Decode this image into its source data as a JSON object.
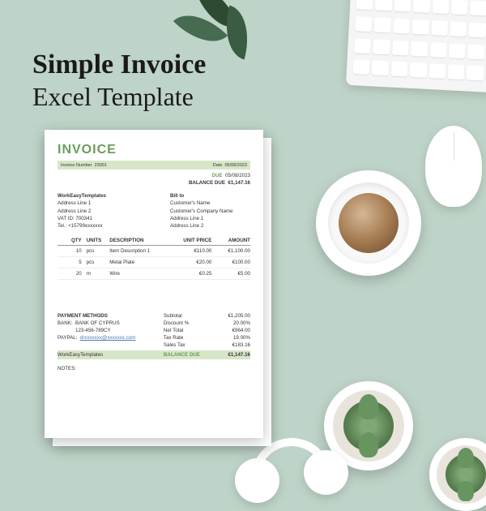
{
  "headline": {
    "line1": "Simple Invoice",
    "line2": "Excel Template"
  },
  "invoice": {
    "title": "INVOICE",
    "number_label": "Invoice Number",
    "number": "23001",
    "date_label": "Date",
    "date": "05/08/2023",
    "due_label": "DUE",
    "due_date": "05/08/2023",
    "balance_due_label": "BALANCE DUE",
    "balance_due": "€1,147.16",
    "from": {
      "name": "WorkEasyTemplates",
      "line1": "Address Line 1",
      "line2": "Address Line 2",
      "vat": "VAT ID: 700341",
      "tel": "Tel.: +15799xxxxxxx"
    },
    "bill_to": {
      "label": "Bill to",
      "name": "Customer's Name",
      "company": "Customer's Company Name",
      "line1": "Address Line 1",
      "line2": "Address Line 2"
    },
    "columns": {
      "qty": "QTY",
      "units": "UNITS",
      "description": "DESCRIPTION",
      "unit_price": "UNIT PRICE",
      "amount": "AMOUNT"
    },
    "items": [
      {
        "qty": "10",
        "units": "pcs",
        "description": "Item Description 1",
        "unit_price": "€110.00",
        "amount": "€1,100.00"
      },
      {
        "qty": "5",
        "units": "pcs",
        "description": "Metal Plate",
        "unit_price": "€20.00",
        "amount": "€100.00"
      },
      {
        "qty": "20",
        "units": "m",
        "description": "Wire",
        "unit_price": "€0.25",
        "amount": "€5.00"
      }
    ],
    "payment": {
      "label": "PAYMENT METHODS",
      "bank_label": "BANK:",
      "bank": "BANK OF CYPRUS",
      "acct": "123-456-789CY",
      "paypal_label": "PAYPAL:",
      "paypal": "drxxxxxxx@xxxxxxx.com",
      "signer": "WorkEasyTemplates"
    },
    "totals": {
      "subtotal_label": "Subtotal",
      "subtotal": "€1,205.00",
      "discount_label": "Discount %",
      "discount_pct": "20.00%",
      "net_label": "Net Total",
      "net": "€964.00",
      "tax_rate_label": "Tax Rate",
      "tax_rate": "19.00%",
      "sales_tax_label": "Sales Tax",
      "sales_tax": "€183.16",
      "balance_label": "BALANCE DUE",
      "balance": "€1,147.16"
    },
    "notes_label": "NOTES:"
  }
}
